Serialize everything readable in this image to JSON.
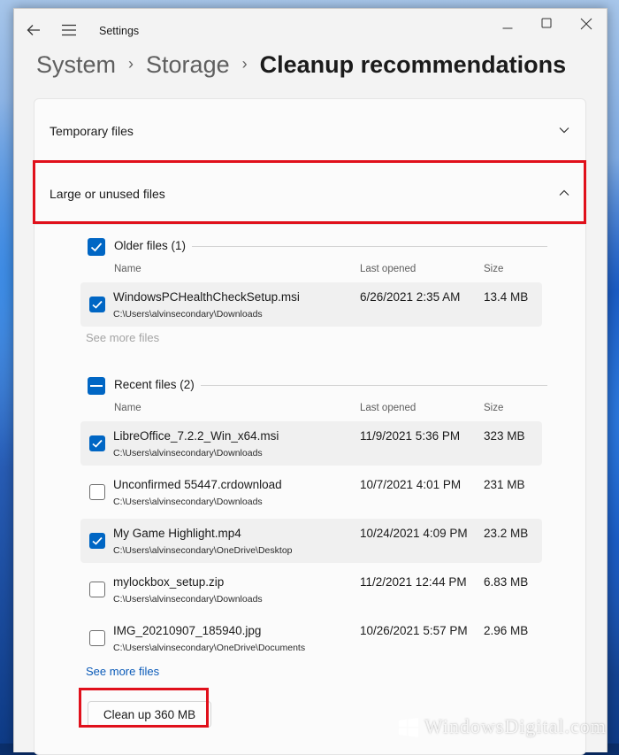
{
  "window": {
    "title": "Settings"
  },
  "breadcrumb": {
    "items": [
      "System",
      "Storage"
    ],
    "current": "Cleanup recommendations",
    "separator": "›"
  },
  "sections": {
    "temporary_files": "Temporary files",
    "large_unused_files": "Large or unused files"
  },
  "older_files": {
    "title": "Older files (1)",
    "checked": true,
    "columns": {
      "name": "Name",
      "last_opened": "Last opened",
      "size": "Size"
    },
    "items": [
      {
        "name": "WindowsPCHealthCheckSetup.msi",
        "path": "C:\\Users\\alvinsecondary\\Downloads",
        "date": "6/26/2021 2:35 AM",
        "size": "13.4 MB",
        "checked": true
      }
    ],
    "see_more": "See more files"
  },
  "recent_files": {
    "title": "Recent files (2)",
    "state": "indeterminate",
    "columns": {
      "name": "Name",
      "last_opened": "Last opened",
      "size": "Size"
    },
    "items": [
      {
        "name": "LibreOffice_7.2.2_Win_x64.msi",
        "path": "C:\\Users\\alvinsecondary\\Downloads",
        "date": "11/9/2021 5:36 PM",
        "size": "323 MB",
        "checked": true
      },
      {
        "name": "Unconfirmed 55447.crdownload",
        "path": "C:\\Users\\alvinsecondary\\Downloads",
        "date": "10/7/2021 4:01 PM",
        "size": "231 MB",
        "checked": false
      },
      {
        "name": "My Game Highlight.mp4",
        "path": "C:\\Users\\alvinsecondary\\OneDrive\\Desktop",
        "date": "10/24/2021 4:09 PM",
        "size": "23.2 MB",
        "checked": true
      },
      {
        "name": "mylockbox_setup.zip",
        "path": "C:\\Users\\alvinsecondary\\Downloads",
        "date": "11/2/2021 12:44 PM",
        "size": "6.83 MB",
        "checked": false
      },
      {
        "name": "IMG_20210907_185940.jpg",
        "path": "C:\\Users\\alvinsecondary\\OneDrive\\Documents",
        "date": "10/26/2021 5:57 PM",
        "size": "2.96 MB",
        "checked": false
      }
    ],
    "see_more": "See more files"
  },
  "cleanup_button": "Clean up 360 MB",
  "watermark": "WindowsDigital.com",
  "colors": {
    "accent": "#0066c4",
    "highlight": "#e0101b",
    "link": "#0a5ab8"
  }
}
